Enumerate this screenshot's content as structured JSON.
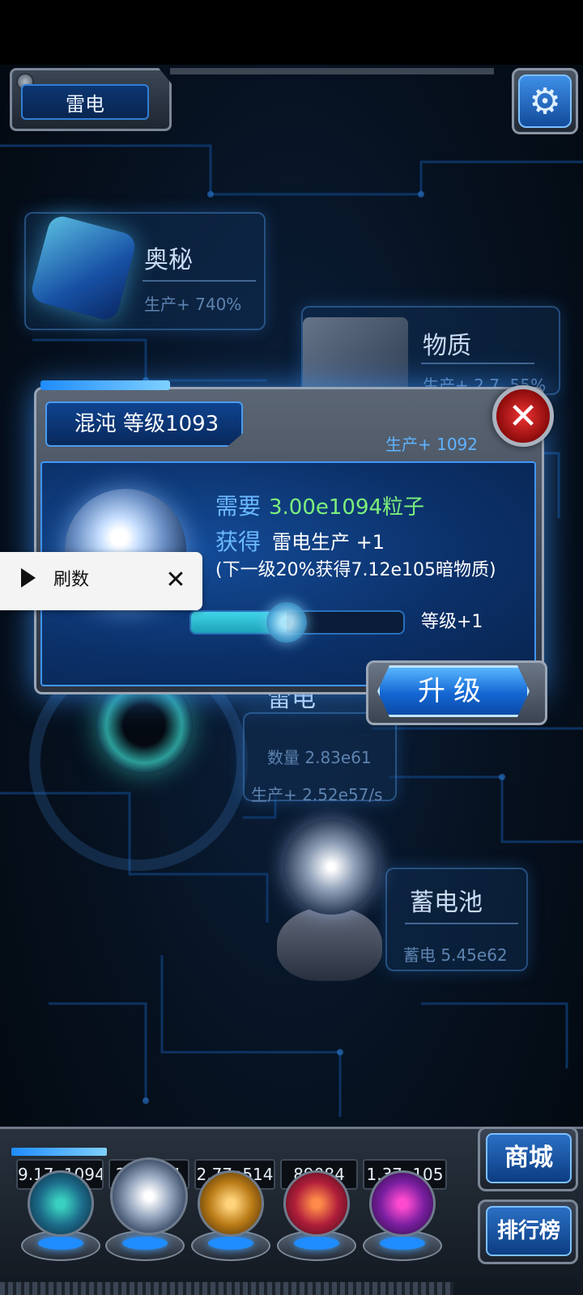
{
  "header": {
    "title": "雷电",
    "settings_icon": "gear-icon"
  },
  "cards": {
    "mystery": {
      "title": "奥秘",
      "production": "生产+ 740%"
    },
    "matter": {
      "title": "物质",
      "production": "生产+ 2.7..55%"
    },
    "thunder": {
      "title": "雷电",
      "count": "数量 2.83e61",
      "production": "生产+ 2.52e57/s"
    },
    "battery": {
      "title": "蓄电池",
      "charge": "蓄电 5.45e62"
    }
  },
  "modal": {
    "title": "混沌 等级1093",
    "production": "生产+ 1092",
    "require_label": "需要",
    "require_value": "3.00e1094粒子",
    "gain_label": "获得",
    "gain_value": "雷电生产 +1",
    "gain_note": "(下一级20%获得7.12e105暗物质)",
    "progress": 0.45,
    "level_step": "等级+1",
    "upgrade_label": "升级",
    "close_icon": "close-icon"
  },
  "overlay": {
    "label": "刷数",
    "play_icon": "play-icon",
    "close_icon": "close-icon"
  },
  "bottom": {
    "counts": [
      "9.17e1094",
      "2.40e61",
      "2.77e514",
      "89084",
      "1.37e105"
    ],
    "shop_label": "商城",
    "ranking_label": "排行榜"
  },
  "colors": {
    "accent": "#1f8cff",
    "require_value": "#7cf07c",
    "close_red": "#cc1f1f"
  }
}
